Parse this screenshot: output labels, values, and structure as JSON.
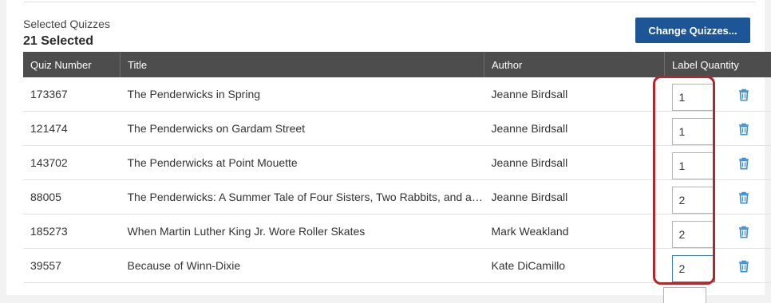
{
  "header": {
    "selected_label": "Selected Quizzes",
    "selected_count": "21 Selected",
    "change_button": "Change Quizzes..."
  },
  "table": {
    "columns": [
      "Quiz Number",
      "Title",
      "Author",
      "Label Quantity"
    ],
    "rows": [
      {
        "quiz_number": "173367",
        "title": "The Penderwicks in Spring",
        "author": "Jeanne Birdsall",
        "quantity": "1"
      },
      {
        "quiz_number": "121474",
        "title": "The Penderwicks on Gardam Street",
        "author": "Jeanne Birdsall",
        "quantity": "1"
      },
      {
        "quiz_number": "143702",
        "title": "The Penderwicks at Point Mouette",
        "author": "Jeanne Birdsall",
        "quantity": "1"
      },
      {
        "quiz_number": "88005",
        "title": "The Penderwicks: A Summer Tale of Four Sisters, Two Rabbits, and a Very Interesting Boy",
        "author": "Jeanne Birdsall",
        "quantity": "2"
      },
      {
        "quiz_number": "185273",
        "title": "When Martin Luther King Jr. Wore Roller Skates",
        "author": "Mark Weakland",
        "quantity": "2"
      },
      {
        "quiz_number": "39557",
        "title": "Because of Winn-Dixie",
        "author": "Kate DiCamillo",
        "quantity": "2"
      }
    ]
  },
  "colors": {
    "header_bg": "#4d4d4d",
    "button_bg": "#1d5696",
    "highlight": "#b3262a",
    "trash_icon": "#3d8fd6"
  }
}
